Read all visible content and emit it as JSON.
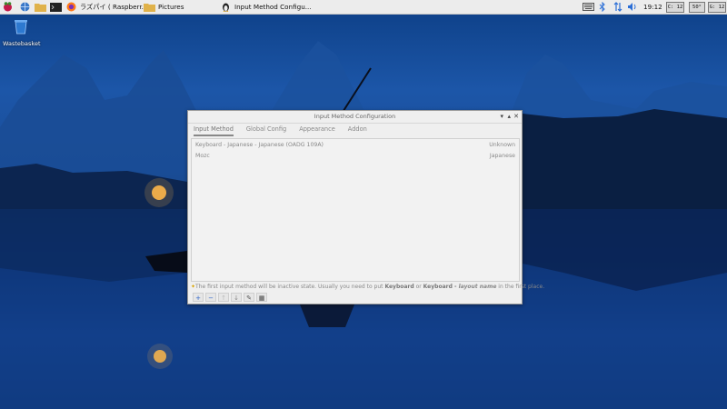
{
  "taskbar": {
    "tasks": [
      {
        "label": "ラズパイ ( Raspberr..."
      },
      {
        "label": "Pictures"
      },
      {
        "label": "Input Method Configu..."
      }
    ],
    "clock": "19:12",
    "cpu": "C: 12",
    "temp": "50°",
    "gpu": "G: 12"
  },
  "desktop": {
    "wastebasket_label": "Wastebasket"
  },
  "dialog": {
    "title": "Input Method Configuration",
    "tabs": [
      "Input Method",
      "Global Config",
      "Appearance",
      "Addon"
    ],
    "rows": [
      {
        "name": "Keyboard - Japanese - Japanese (OADG 109A)",
        "lang": "Unknown"
      },
      {
        "name": "Mozc",
        "lang": "Japanese"
      }
    ],
    "hint": {
      "part1": "The first input method will be inactive state. Usually you need to put ",
      "bold1": "Keyboard",
      "part2": " or ",
      "bold2": "Keyboard - ",
      "italic": "layout name",
      "part3": " in the first place."
    },
    "tools": [
      "+",
      "−",
      "↑",
      "↓",
      "✎",
      "▦"
    ]
  }
}
